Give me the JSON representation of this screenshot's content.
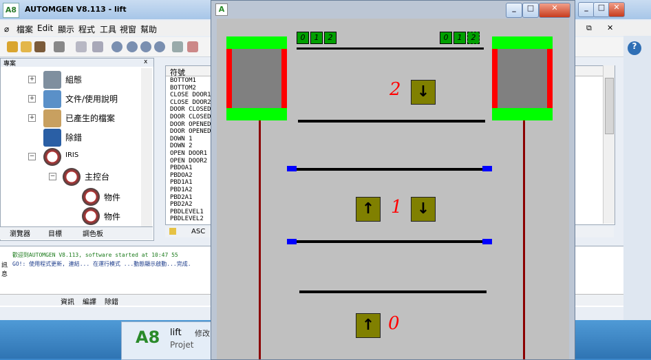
{
  "main_window": {
    "title": "AUTOMGEN V8.113 - lift",
    "logo": "A8",
    "minimize": "_",
    "maximize": "□",
    "close": "✕",
    "restore": "⧉"
  },
  "menubar": [
    "檔案",
    "Edit",
    "顯示",
    "程式",
    "工具",
    "視窗",
    "幫助"
  ],
  "toolbar_icons": [
    "new-icon",
    "open-icon",
    "save-icon",
    "print-icon",
    "cut-icon",
    "copy-icon",
    "run-icon",
    "pause-icon",
    "stop-icon",
    "step-icon",
    "find-icon",
    "options-icon"
  ],
  "project_panel": {
    "header": "專案",
    "close": "x",
    "tree": [
      {
        "label": "組態",
        "expander": "+",
        "icon": "tools-icon"
      },
      {
        "label": "文件/使用說明",
        "expander": "+",
        "icon": "printer-icon"
      },
      {
        "label": "已產生的檔案",
        "expander": "+",
        "icon": "box-icon"
      },
      {
        "label": "除錯",
        "expander": "",
        "icon": "monitor-icon"
      },
      {
        "label": "IRIS",
        "expander": "−",
        "icon": "gauge-icon"
      },
      {
        "label": "主控台",
        "expander": "−",
        "icon": "gauge-icon"
      },
      {
        "label": "物件",
        "expander": "",
        "icon": "gauge-icon"
      },
      {
        "label": "物件",
        "expander": "",
        "icon": "gauge-icon"
      }
    ],
    "tabs": [
      "瀏覽器",
      "目標",
      "調色板"
    ]
  },
  "symbols": {
    "header": "符號",
    "items": [
      "BOTTOM1",
      "BOTTOM2",
      "CLOSE DOOR1",
      "CLOSE DOOR2",
      "DOOR CLOSED1",
      "DOOR CLOSED2",
      "DOOR OPENED1",
      "DOOR OPENED2",
      "DOWN 1",
      "DOWN 2",
      "OPEN DOOR1",
      "OPEN DOOR2",
      "PBDOA1",
      "PBDOA2",
      "PBD1A1",
      "PBD1A2",
      "PBD2A1",
      "PBD2A2",
      "PBDLEVEL1",
      "PBDLEVEL2"
    ],
    "footer_label": "ASC"
  },
  "messages": {
    "lines": [
      "歡迎到AUTOMGEN V8.113, software started at 10:47 55",
      "GO!: 使用程式更新, 連結... 在運行模式 ...動態顯示啟動...完成."
    ],
    "side_label": "訊息",
    "tabs": [
      "資訊",
      "編譯",
      "除錯"
    ]
  },
  "taskbar": {
    "item_title": "lift",
    "item_subtitle": "Projet",
    "item_extra": "修改"
  },
  "lift_window": {
    "logo": "A",
    "minimize": "_",
    "maximize": "□",
    "close": "✕",
    "floors": [
      "2",
      "1",
      "0"
    ],
    "indicators_left": [
      "0",
      "1",
      "2"
    ],
    "indicators_right": [
      "0",
      "1",
      "2"
    ],
    "up_arrow": "↑",
    "down_arrow": "↓"
  },
  "colors": {
    "car_frame": "#00ff00",
    "door": "#ff0000",
    "car_body": "#808080",
    "call_button": "#808000",
    "floor_number": "#ff0000",
    "cable": "#8b0000",
    "floor_sensor": "#0000ff",
    "indicator": "#00a000"
  }
}
